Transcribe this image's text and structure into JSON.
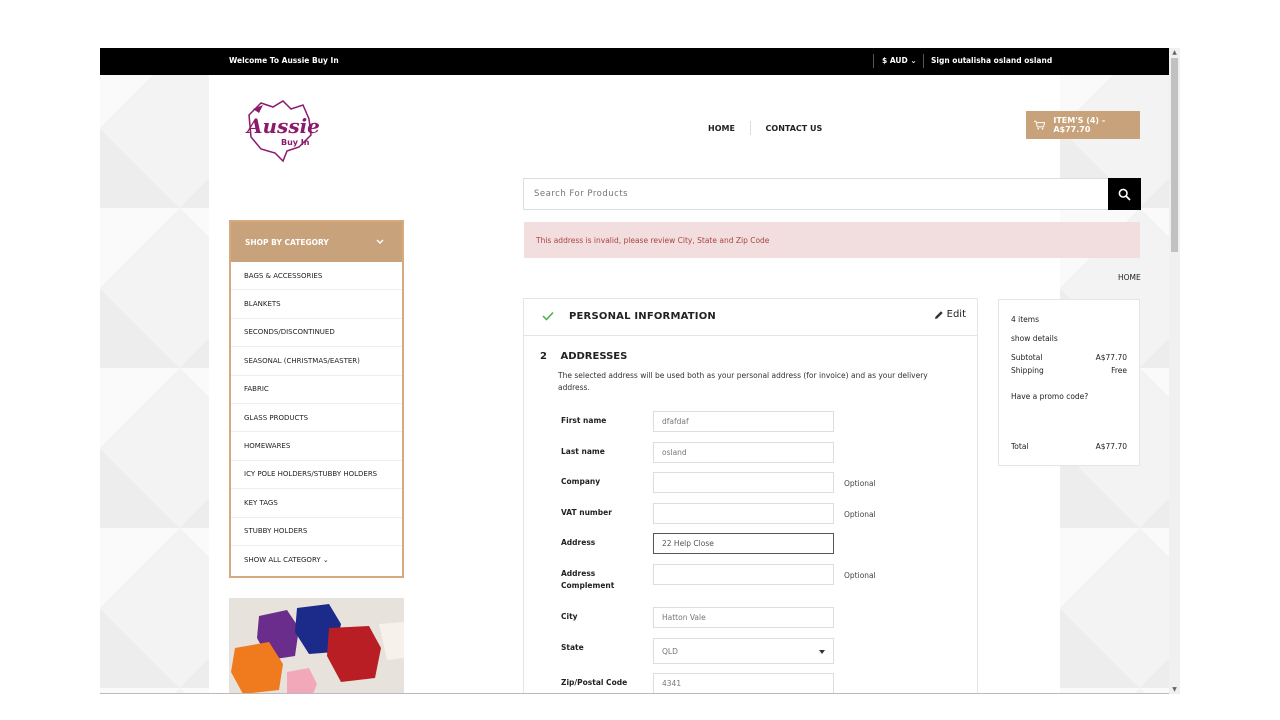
{
  "topbar": {
    "welcome": "Welcome To Aussie Buy In",
    "currency": "$ AUD",
    "sign_out": "Sign out",
    "username": "alisha osland osland"
  },
  "logo": {
    "text_main": "Aussie",
    "text_sub": "Buy In",
    "color": "#8b1a6b"
  },
  "nav": {
    "home": "HOME",
    "contact": "CONTACT US"
  },
  "cart": {
    "label": "ITEM'S (4) - A$77.70"
  },
  "search": {
    "placeholder": "Search For Products"
  },
  "category": {
    "header": "SHOP BY CATEGORY",
    "items": [
      "BAGS & ACCESSORIES",
      "BLANKETS",
      "SECONDS/DISCONTINUED",
      "SEASONAL (CHRISTMAS/EASTER)",
      "FABRIC",
      "GLASS PRODUCTS",
      "HOMEWARES",
      "ICY POLE HOLDERS/STUBBY HOLDERS",
      "KEY TAGS",
      "STUBBY HOLDERS",
      "SHOW ALL CATEGORY"
    ]
  },
  "alert": {
    "message": "This address is invalid, please review City, State and Zip Code"
  },
  "breadcrumb": {
    "home": "HOME"
  },
  "checkout": {
    "step1": {
      "title": "PERSONAL INFORMATION",
      "edit": "Edit"
    },
    "step2": {
      "number": "2",
      "title": "ADDRESSES",
      "description": "The selected address will be used both as your personal address (for invoice) and as your delivery address."
    },
    "fields": {
      "first_name": {
        "label": "First name",
        "value": "dfafdaf"
      },
      "last_name": {
        "label": "Last name",
        "value": "osland"
      },
      "company": {
        "label": "Company",
        "value": "",
        "optional": "Optional"
      },
      "vat": {
        "label": "VAT number",
        "value": "",
        "optional": "Optional"
      },
      "address": {
        "label": "Address",
        "value": "22 Help Close"
      },
      "address2": {
        "label": "Address Complement",
        "value": "",
        "optional": "Optional"
      },
      "city": {
        "label": "City",
        "value": "Hatton Vale"
      },
      "state": {
        "label": "State",
        "value": "QLD"
      },
      "zip": {
        "label": "Zip/Postal Code",
        "value": "4341"
      }
    }
  },
  "summary": {
    "items": "4 items",
    "show_details": "show details",
    "subtotal_label": "Subtotal",
    "subtotal_value": "A$77.70",
    "shipping_label": "Shipping",
    "shipping_value": "Free",
    "promo": "Have a promo code?",
    "total_label": "Total",
    "total_value": "A$77.70"
  },
  "colors": {
    "accent": "#c8a27a",
    "alert_bg": "#f2dede",
    "alert_text": "#a94442",
    "topbar": "#000000"
  }
}
